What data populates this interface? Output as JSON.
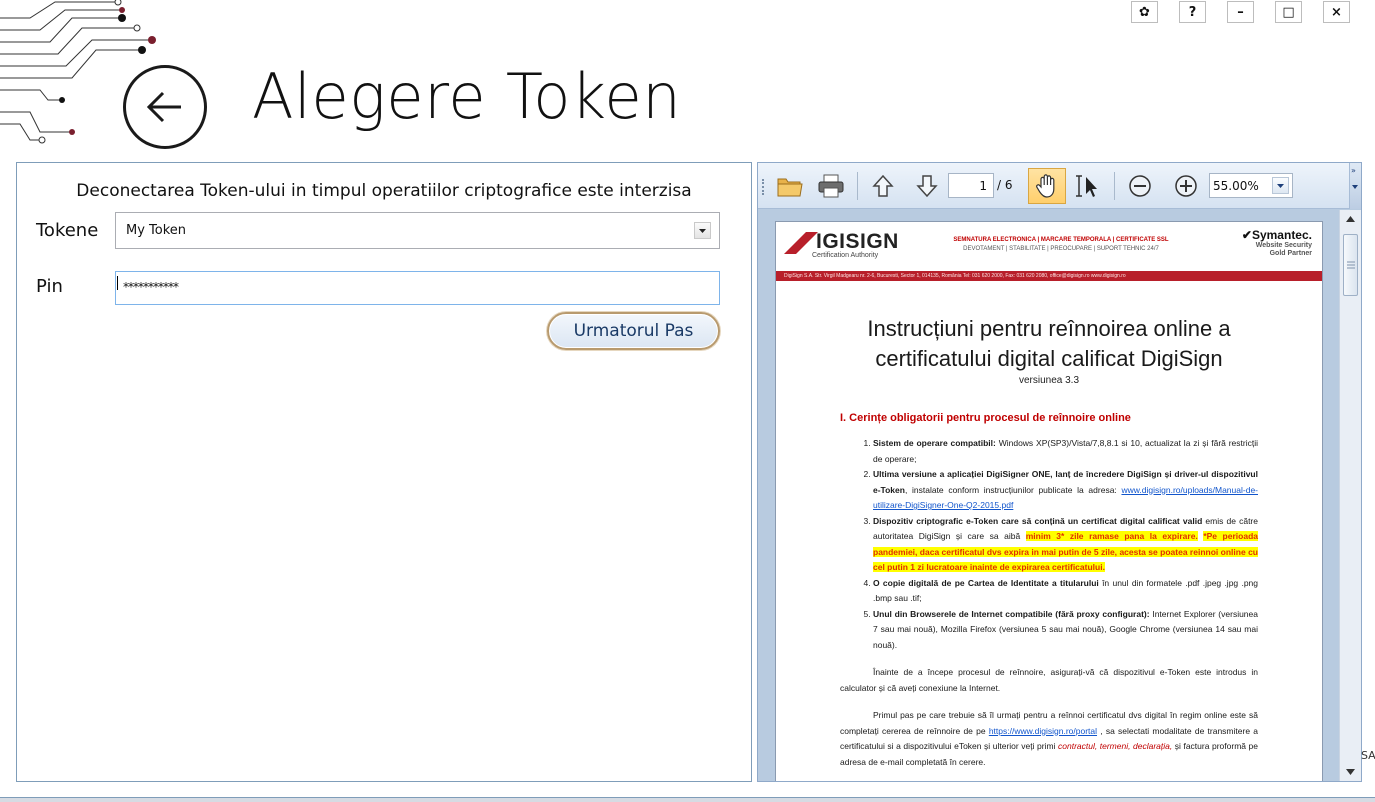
{
  "header": {
    "title": "Alegere Token"
  },
  "window_controls": {
    "settings": "✿",
    "help": "?",
    "minimize": "–",
    "maximize": "□",
    "close": "×"
  },
  "form": {
    "warning": "Deconectarea Token-ului in timpul operatiilor criptografice este interzisa",
    "token_label": "Tokene",
    "token_value": "My Token",
    "pin_label": "Pin",
    "pin_value": "***********",
    "next_button": "Urmatorul Pas"
  },
  "viewer": {
    "page_current": "1",
    "page_total": "/ 6",
    "zoom": "55.00%",
    "document": {
      "logo_name": "IGISIGN",
      "logo_sub": "Certification Authority",
      "slogan_line1": "SEMNATURA ELECTRONICA | MARCARE TEMPORALA | CERTIFICATE SSL",
      "slogan_line2": "DEVOTAMENT | STABILITATE | PREOCUPARE | SUPORT TEHNIC 24/7",
      "partner_brand": "✔Symantec.",
      "partner_line1": "Website Security",
      "partner_line2": "Gold Partner",
      "address_bar": "DigiSign S.A.    Str. Virgil Madgearu nr. 2-6, Bucuresti, Sector 1, 014135, România Tel: 031 620 2000, Fax: 031 620 2080, office@digisign.ro        www.digisign.ro",
      "title": "Instrucțiuni pentru reînnoirea online a certificatului digital calificat DigiSign",
      "version": "versiunea 3.3",
      "heading": "I. Cerințe obligatorii pentru procesul de reînnoire online",
      "item1_bold": "Sistem de operare compatibil:",
      "item1_text": " Windows XP(SP3)/Vista/7,8,8.1 si 10, actualizat la zi și fără restricții de operare;",
      "item2_bold": "Ultima versiune a aplicației DigiSigner ONE, lanț de încredere DigiSign și driver-ul dispozitivul e-Token",
      "item2_text": ", instalate conform instrucțiunilor publicate la adresa: ",
      "item2_link": "www.digisign.ro/uploads/Manual-de-utilizare-DigiSigner-One-Q2-2015.pdf",
      "item3_bold": "Dispozitiv criptografic e-Token care să conțină un certificat digital calificat valid",
      "item3_text": " emis de către autoritatea DigiSign și care sa aibă ",
      "item3_hl1": "minim 3* zile ramase pana la expirare.",
      "item3_hl2": "*Pe perioada pandemiei, daca certificatul dvs expira in mai putin de 5 zile, acesta se poatea reinnoi online cu cel putin 1 zi lucratoare inainte de expirarea certificatului.",
      "item4_bold": "O copie digitală de pe Cartea de Identitate a titularului",
      "item4_text": " în unul din formatele .pdf .jpeg .jpg .png .bmp sau .tif;",
      "item5_bold": "Unul din Browserele de Internet compatibile (fără proxy configurat):",
      "item5_text": " Internet Explorer (versiunea 7 sau mai nouă), Mozilla Firefox (versiunea 5 sau mai nouă), Google Chrome (versiunea 14 sau mai nouă).",
      "para1": "Înainte de a începe procesul de reînnoire, asigurați-vă că dispozitivul e-Token este introdus in calculator și că aveți conexiune la Internet.",
      "para2_a": "Primul pas pe care trebuie să îl urmați pentru a reînnoi certificatul dvs digital în regim online este să completați cererea de reînnoire de pe ",
      "para2_link": "https://www.digisign.ro/portal",
      "para2_b": " , sa selectati modalitate de transmitere a certificatului si a dispozitivului eToken și ulterior veți primi ",
      "para2_red": "contractul, termeni, declarația,",
      "para2_c": " și factura proformă pe adresa de e-mail completată în cerere."
    }
  },
  "edge_text": "SA",
  "colors": {
    "accent_red": "#b81f2a",
    "button_border": "#b89a6e",
    "panel_border": "#7f9db9",
    "highlight": "#ffff00"
  }
}
